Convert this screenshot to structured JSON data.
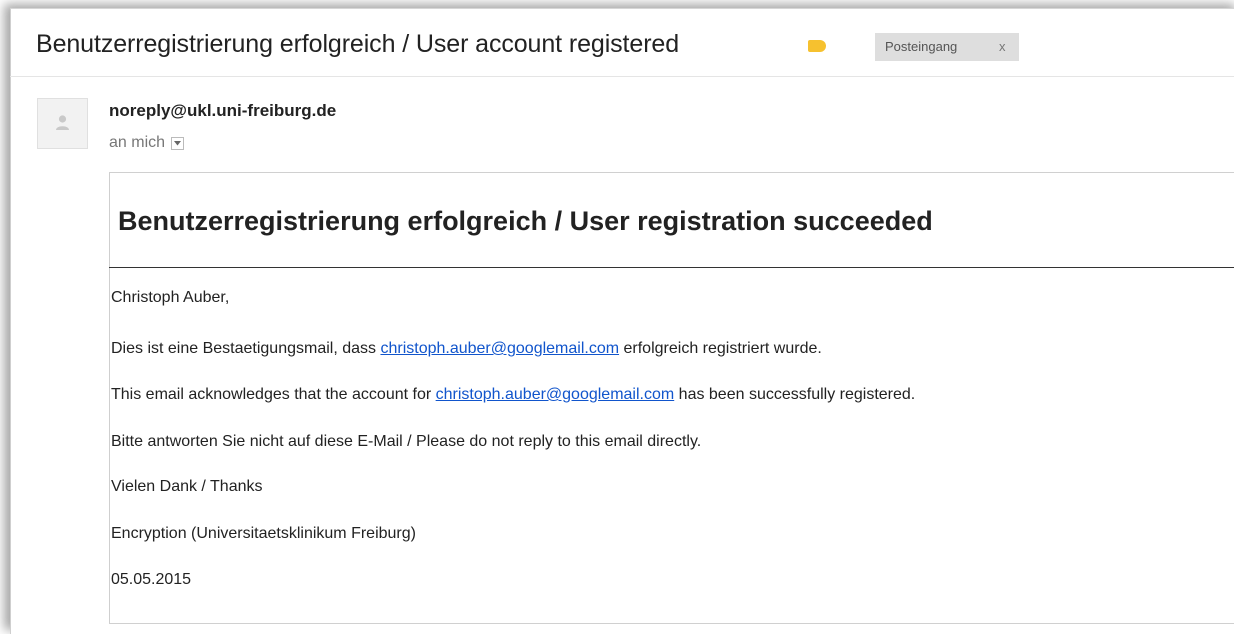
{
  "header": {
    "subject": "Benutzerregistrierung erfolgreich / User account registered",
    "label_chip": "Posteingang",
    "chip_close": "x",
    "label_color": "#f6c12f"
  },
  "sender": {
    "email": "noreply@ukl.uni-freiburg.de",
    "recipient": "an mich"
  },
  "message": {
    "headline": "Benutzerregistrierung erfolgreich / User registration succeeded",
    "greeting": "Christoph Auber,",
    "line_de_prefix": "Dies ist eine Bestaetigungsmail, dass ",
    "line_de_link": "christoph.auber@googlemail.com",
    "line_de_suffix": " erfolgreich registriert wurde.",
    "line_en_prefix": "This email acknowledges that the account for ",
    "line_en_link": "christoph.auber@googlemail.com",
    "line_en_suffix": " has been successfully registered.",
    "noreply_note": "Bitte antworten Sie nicht auf diese E-Mail / Please do not reply to this email directly.",
    "thanks": "Vielen Dank / Thanks",
    "signature": "Encryption (Universitaetsklinikum Freiburg)",
    "date": "05.05.2015",
    "link_color": "#1155cc"
  }
}
